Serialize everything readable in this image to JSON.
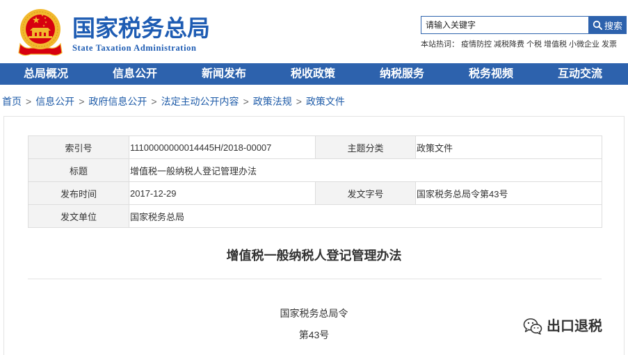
{
  "site": {
    "title_cn": "国家税务总局",
    "title_en": "State Taxation Administration"
  },
  "search": {
    "placeholder": "请输入关键字",
    "button_label": "搜索"
  },
  "hot_words": {
    "label": "本站热词：",
    "items": [
      "疫情防控",
      "减税降费",
      "个税",
      "增值税",
      "小微企业",
      "发票"
    ]
  },
  "nav": {
    "items": [
      "总局概况",
      "信息公开",
      "新闻发布",
      "税收政策",
      "纳税服务",
      "税务视频",
      "互动交流"
    ]
  },
  "breadcrumb": {
    "separator": ">",
    "items": [
      "首页",
      "信息公开",
      "政府信息公开",
      "法定主动公开内容",
      "政策法规",
      "政策文件"
    ]
  },
  "info_table": {
    "rows": [
      {
        "label1": "索引号",
        "value1": "11100000000014445H/2018-00007",
        "label2": "主题分类",
        "value2": "政策文件"
      },
      {
        "label1": "标题",
        "value1": "增值税一般纳税人登记管理办法"
      },
      {
        "label1": "发布时间",
        "value1": "2017-12-29",
        "label2": "发文字号",
        "value2": "国家税务总局令第43号"
      },
      {
        "label1": "发文单位",
        "value1": "国家税务总局"
      }
    ]
  },
  "article": {
    "title": "增值税一般纳税人登记管理办法",
    "lines": [
      "国家税务总局令",
      "第43号"
    ]
  },
  "watermark": {
    "text": "出口退税"
  },
  "icons": {
    "emblem": "national-emblem-icon",
    "search": "search-icon",
    "watermark": "wechat-icon"
  },
  "colors": {
    "brand_blue": "#1e5cb3",
    "nav_bg": "#2d62ad",
    "link_blue": "#1e5ba8",
    "label_bg": "#f3f3f3",
    "emblem_red": "#d7000f",
    "emblem_gold": "#f2b92e"
  }
}
